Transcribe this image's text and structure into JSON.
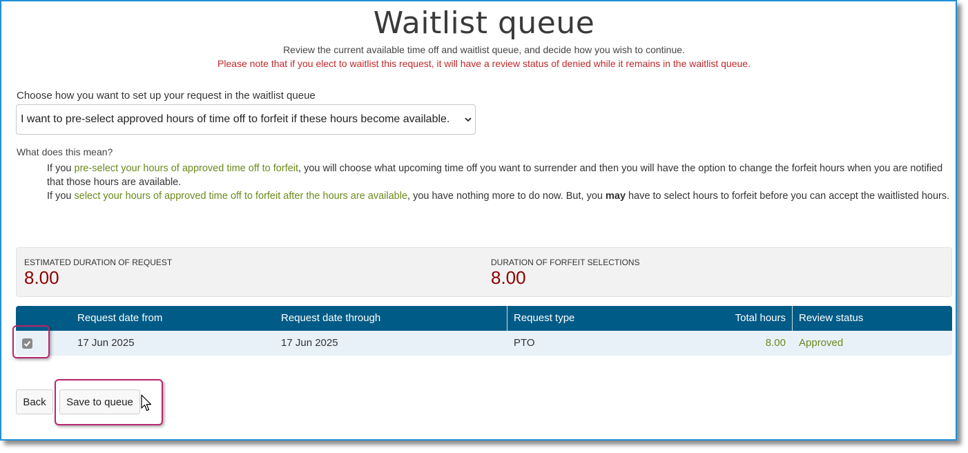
{
  "page": {
    "title": "Waitlist queue",
    "subtitle": "Review the current available time off and waitlist queue, and decide how you wish to continue.",
    "warning": "Please note that if you elect to waitlist this request, it will have a review status of denied while it remains in the waitlist queue."
  },
  "select": {
    "label": "Choose how you want to set up your request in the waitlist queue",
    "value": "I want to pre-select approved hours of time off to forfeit if these hours become available."
  },
  "explanation": {
    "heading": "What does this mean?",
    "p1_prefix": "If you ",
    "p1_highlight": "pre-select your hours of approved time off to forfeit",
    "p1_suffix": ", you will choose what upcoming time off you want to surrender and then you will have the option to change the forfeit hours when you are notified that those hours are available.",
    "p2_prefix": "If you ",
    "p2_highlight": "select your hours of approved time off to forfeit after the hours are available",
    "p2_mid": ", you have nothing more to do now. But, you ",
    "p2_bold": "may",
    "p2_suffix": " have to select hours to forfeit before you can accept the waitlisted hours."
  },
  "summary": {
    "estimated_label": "ESTIMATED DURATION OF REQUEST",
    "estimated_value": "8.00",
    "forfeit_label": "DURATION OF FORFEIT SELECTIONS",
    "forfeit_value": "8.00"
  },
  "table": {
    "headers": {
      "date_from": "Request date from",
      "date_through": "Request date through",
      "type": "Request type",
      "total_hours": "Total hours",
      "review_status": "Review status"
    },
    "rows": [
      {
        "checked": true,
        "date_from": "17 Jun 2025",
        "date_through": "17 Jun 2025",
        "type": "PTO",
        "total_hours": "8.00",
        "review_status": "Approved"
      }
    ]
  },
  "buttons": {
    "back": "Back",
    "save": "Save to queue"
  },
  "icons": {
    "checkbox": "check-icon",
    "select": "chevron-down-icon",
    "cursor": "mouse-pointer-icon"
  },
  "colors": {
    "header_bg": "#005b86",
    "warning": "#c0282b",
    "summary_value": "#8b0000",
    "green_text": "#6a8a1c",
    "highlight": "#b8256e",
    "frame": "#1f8fd6"
  }
}
